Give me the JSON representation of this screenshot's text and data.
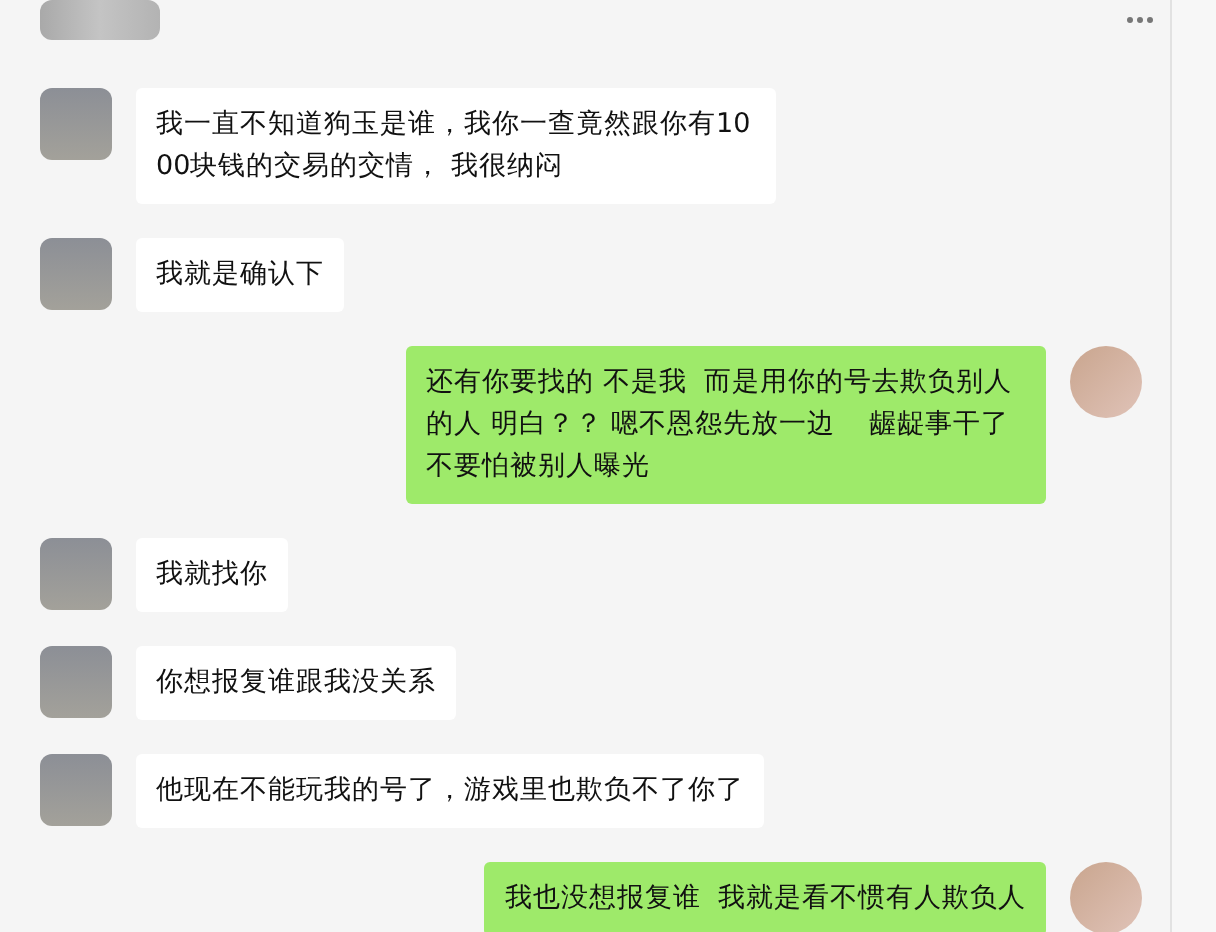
{
  "messages": [
    {
      "kind": "incoming",
      "text": "我一直不知道狗玉是谁，我你一查竟然跟你有1000块钱的交易的交情， 我很纳闷"
    },
    {
      "kind": "incoming",
      "text": "我就是确认下"
    },
    {
      "kind": "outgoing",
      "text": "还有你要找的 不是我  而是用你的号去欺负别人的人 明白？？ 嗯不恩怨先放一边    龌龊事干了不要怕被别人曝光"
    },
    {
      "kind": "incoming",
      "text": "我就找你"
    },
    {
      "kind": "incoming",
      "text": "你想报复谁跟我没关系"
    },
    {
      "kind": "incoming",
      "text": "他现在不能玩我的号了，游戏里也欺负不了你了"
    },
    {
      "kind": "outgoing",
      "text": "我也没想报复谁  我就是看不惯有人欺负人"
    }
  ]
}
